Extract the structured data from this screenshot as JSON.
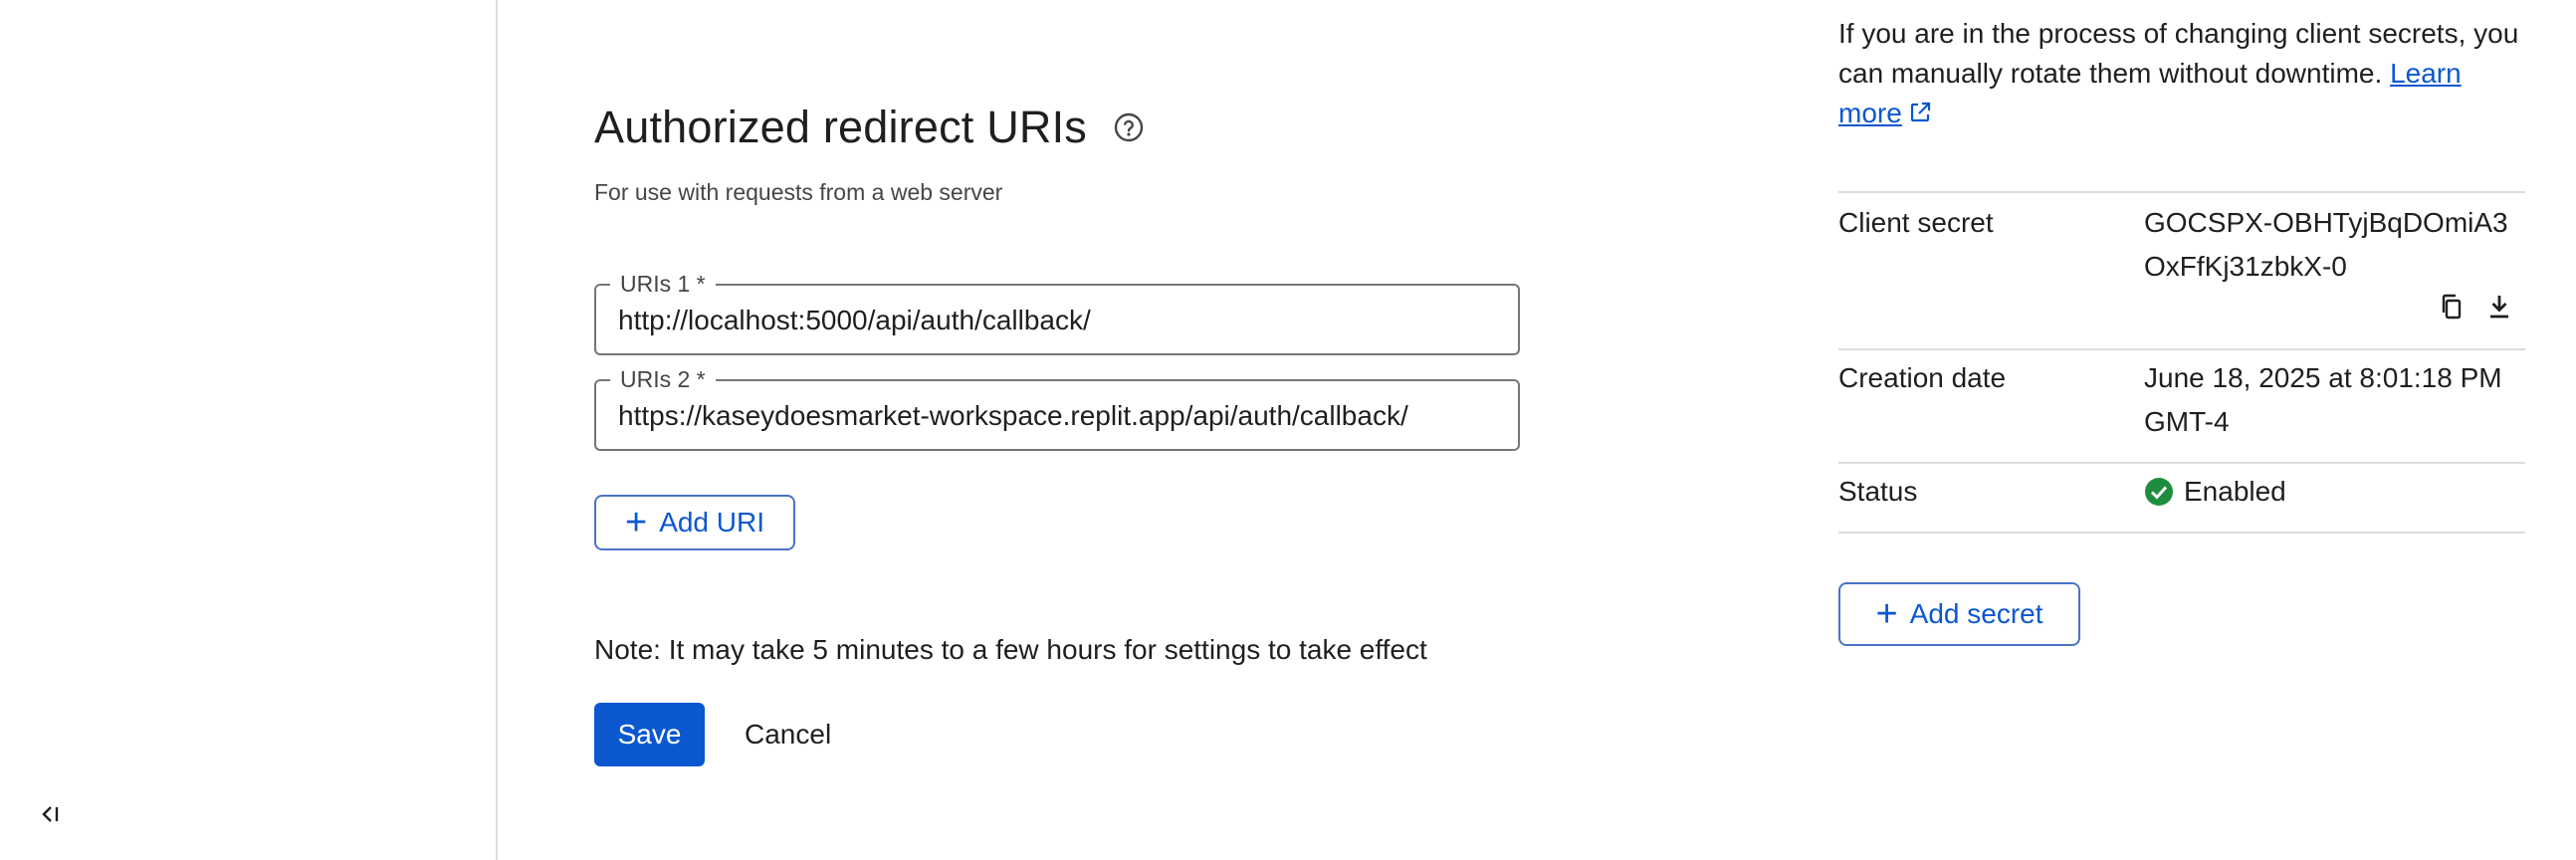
{
  "left_rail": {
    "collapse_icon": "collapse-left-icon"
  },
  "redirect": {
    "title": "Authorized redirect URIs",
    "help_icon": "help-circle-icon",
    "subtitle": "For use with requests from a web server",
    "uris": [
      {
        "label": "URIs 1 *",
        "value": "http://localhost:5000/api/auth/callback/"
      },
      {
        "label": "URIs 2 *",
        "value": "https://kaseydoesmarket-workspace.replit.app/api/auth/callback/"
      }
    ],
    "add_uri_label": "Add URI",
    "note": "Note: It may take 5 minutes to a few hours for settings to take effect",
    "save_label": "Save",
    "cancel_label": "Cancel"
  },
  "secrets": {
    "rotate_text": "If you are in the process of changing client secrets, you can manually rotate them without downtime.",
    "learn_more_label": "Learn more",
    "client_secret_key": "Client secret",
    "client_secret_value": "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",
    "creation_date_key": "Creation date",
    "creation_date_value": "June 18, 2025 at 8:01:18 PM GMT-4",
    "status_key": "Status",
    "status_value": "Enabled",
    "add_secret_label": "Add secret"
  },
  "colors": {
    "primary": "#0b57d0",
    "success": "#1e8e3e",
    "divider": "#dadce0"
  }
}
